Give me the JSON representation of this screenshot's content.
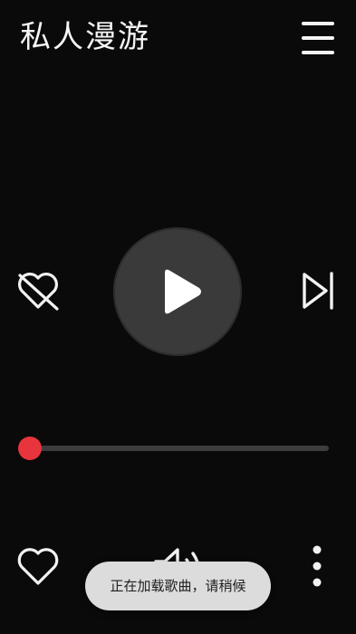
{
  "header": {
    "title": "私人漫游",
    "menu_icon": "hamburger-menu-icon"
  },
  "controls": {
    "dislike_icon": "heart-crossed-icon",
    "play_icon": "play-icon",
    "next_icon": "skip-next-icon"
  },
  "progress": {
    "value": 0
  },
  "bottom_bar": {
    "like_icon": "heart-outline-icon",
    "volume_icon": "volume-icon",
    "more_icon": "more-vertical-icon"
  },
  "pager": {
    "pages": 2,
    "active": 0
  },
  "toast": {
    "message": "正在加载歌曲，请稍候"
  },
  "colors": {
    "background": "#0a0a0a",
    "accent": "#e8343c",
    "play_button": "#3a3a3a",
    "toast_background": "#dcdcdc"
  }
}
